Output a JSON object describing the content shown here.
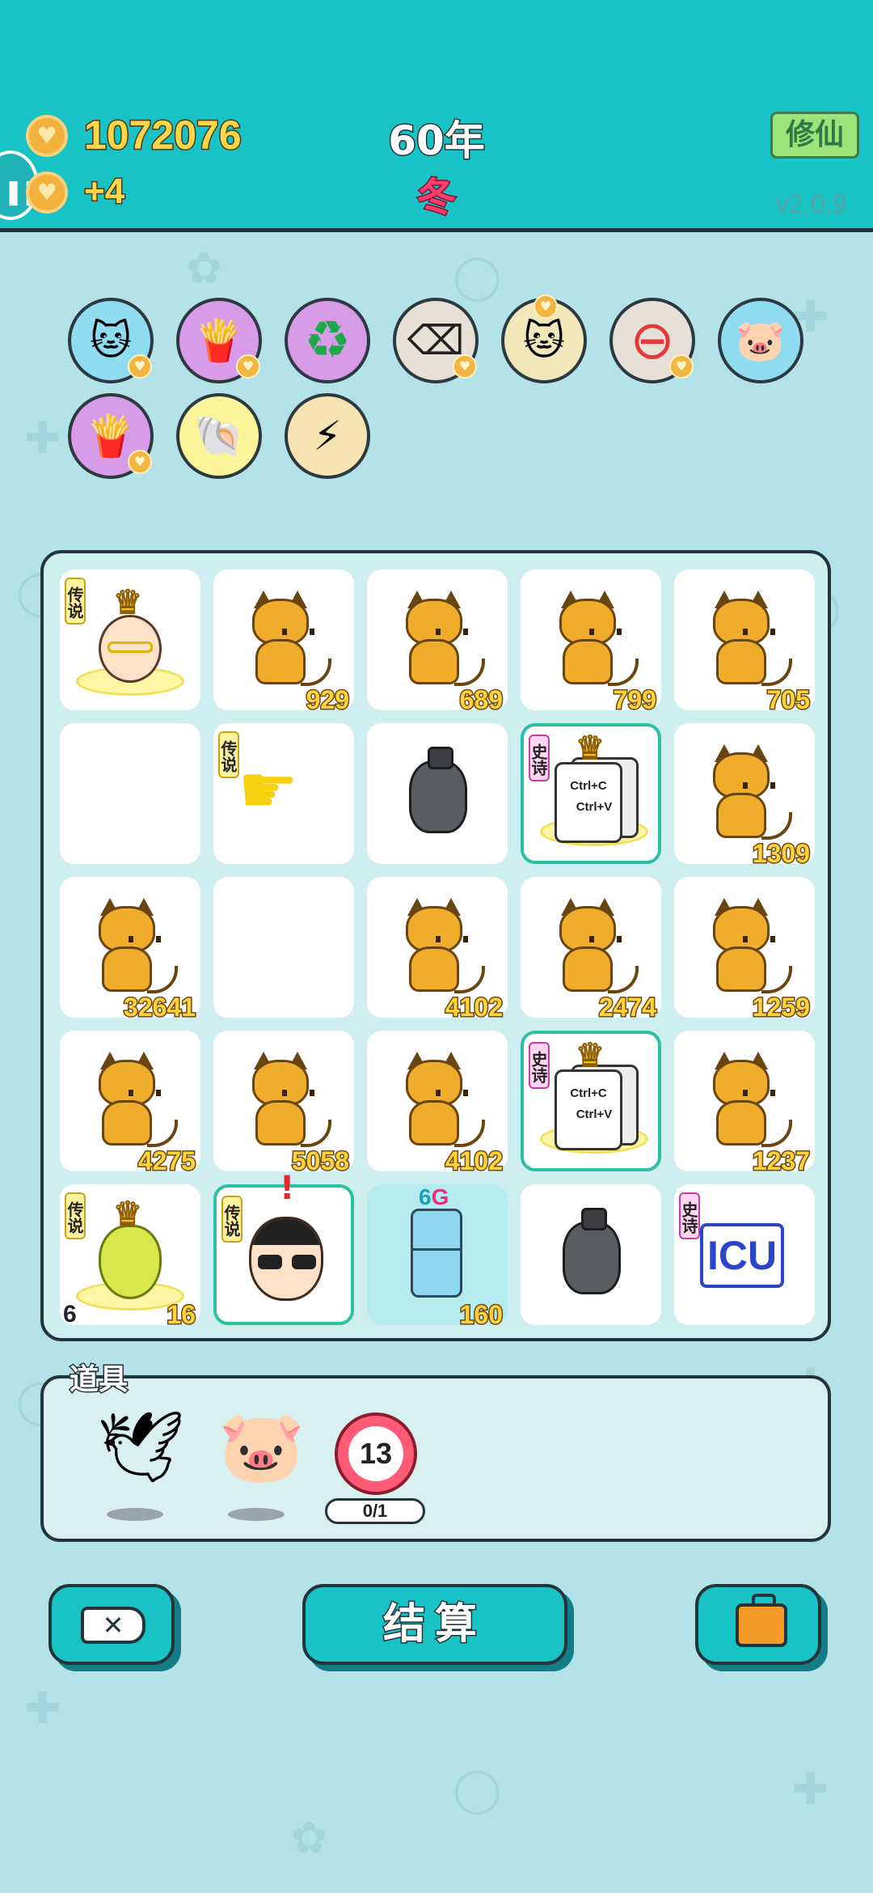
{
  "header": {
    "coins": "1072076",
    "coin_rate": "+4",
    "year": "60年",
    "season": "冬",
    "cultivate_label": "修仙",
    "version": "v2.0.9"
  },
  "buffs": [
    {
      "name": "cat-buff",
      "icon": "🐱"
    },
    {
      "name": "fries-buff",
      "icon": "🍟"
    },
    {
      "name": "recycle-buff",
      "icon": "♻"
    },
    {
      "name": "delete-buff",
      "icon": "⌫"
    },
    {
      "name": "twin-cats-buff",
      "icon": "🐱"
    },
    {
      "name": "minus-buff",
      "icon": "⊖"
    },
    {
      "name": "piggy-bank-buff",
      "icon": "🐷"
    },
    {
      "name": "fries-buff-2",
      "icon": "🍟"
    },
    {
      "name": "shell-buff",
      "icon": "🐚"
    },
    {
      "name": "lightning-buff",
      "icon": "⚡"
    }
  ],
  "board": {
    "rows": [
      [
        {
          "kind": "legend-face",
          "tag": "传说"
        },
        {
          "kind": "cat",
          "value": "929"
        },
        {
          "kind": "cat",
          "value": "689"
        },
        {
          "kind": "cat",
          "value": "799"
        },
        {
          "kind": "cat",
          "value": "705"
        }
      ],
      [
        {
          "kind": "empty"
        },
        {
          "kind": "hand",
          "tag": "传说"
        },
        {
          "kind": "trash-bag"
        },
        {
          "kind": "ctrl-cv",
          "tag": "史诗",
          "line1": "Ctrl+C",
          "line2": "Ctrl+V"
        },
        {
          "kind": "cat",
          "value": "1309"
        }
      ],
      [
        {
          "kind": "cat",
          "value": "32641"
        },
        {
          "kind": "empty"
        },
        {
          "kind": "cat",
          "value": "4102"
        },
        {
          "kind": "cat",
          "value": "2474"
        },
        {
          "kind": "cat",
          "value": "1259"
        }
      ],
      [
        {
          "kind": "cat",
          "value": "4275"
        },
        {
          "kind": "cat",
          "value": "5058"
        },
        {
          "kind": "cat",
          "value": "4102"
        },
        {
          "kind": "ctrl-cv",
          "tag": "史诗",
          "line1": "Ctrl+C",
          "line2": "Ctrl+V"
        },
        {
          "kind": "cat",
          "value": "1237"
        }
      ],
      [
        {
          "kind": "gourd",
          "tag": "传说",
          "level": "6",
          "value": "16"
        },
        {
          "kind": "sunglasses-man",
          "tag": "传说",
          "alert": "!"
        },
        {
          "kind": "fridge",
          "top_label_a": "6",
          "top_label_b": "G",
          "value": "160"
        },
        {
          "kind": "trash-bag"
        },
        {
          "kind": "icu",
          "tag": "史诗",
          "text": "ICU"
        }
      ]
    ]
  },
  "tools": {
    "title": "道具",
    "items": [
      {
        "name": "dove",
        "icon": "🕊"
      },
      {
        "name": "piggy-bank",
        "icon": "🐷"
      }
    ],
    "timer_value": "13",
    "timer_count": "0/1"
  },
  "buttons": {
    "settle_label": "结算"
  },
  "colors": {
    "header_bg": "#18c3c5",
    "page_bg": "#b3e3e8",
    "value_gold": "#ffd13a",
    "season_red": "#ff3c6b"
  }
}
